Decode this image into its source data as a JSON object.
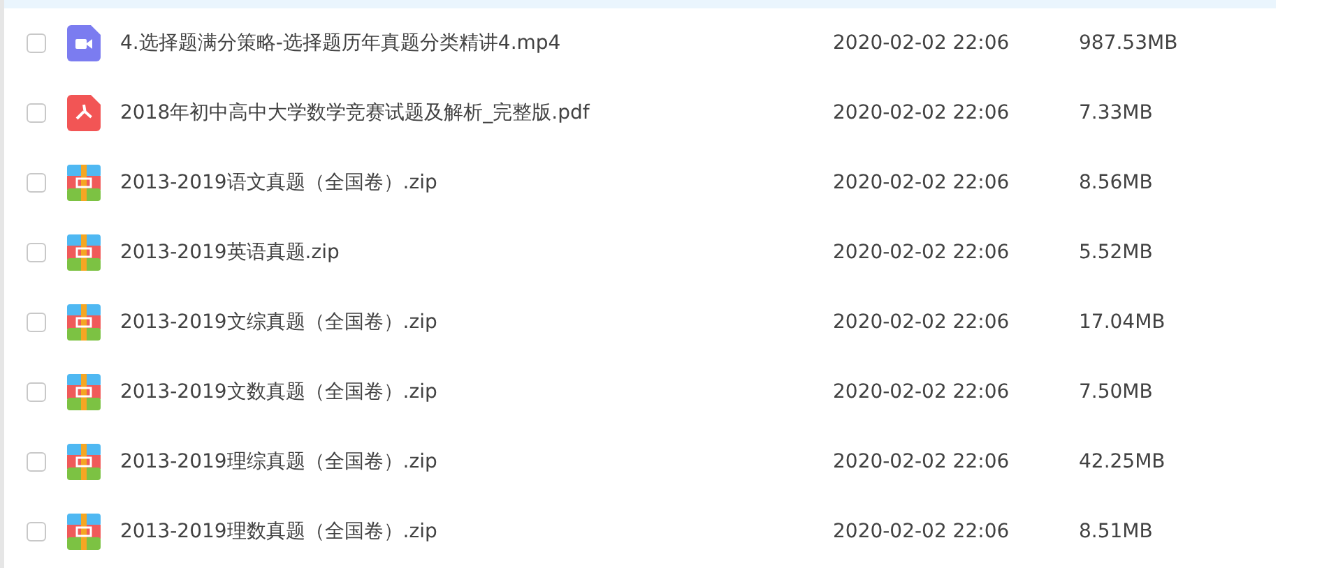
{
  "files": [
    {
      "kind": "video",
      "name": "4.选择题满分策略-选择题历年真题分类精讲4.mp4",
      "modified": "2020-02-02 22:06",
      "size": "987.53MB",
      "checked": false
    },
    {
      "kind": "pdf",
      "name": "2018年初中高中大学数学竞赛试题及解析_完整版.pdf",
      "modified": "2020-02-02 22:06",
      "size": "7.33MB",
      "checked": false
    },
    {
      "kind": "zip",
      "name": "2013-2019语文真题（全国卷）.zip",
      "modified": "2020-02-02 22:06",
      "size": "8.56MB",
      "checked": false
    },
    {
      "kind": "zip",
      "name": "2013-2019英语真题.zip",
      "modified": "2020-02-02 22:06",
      "size": "5.52MB",
      "checked": false
    },
    {
      "kind": "zip",
      "name": "2013-2019文综真题（全国卷）.zip",
      "modified": "2020-02-02 22:06",
      "size": "17.04MB",
      "checked": false
    },
    {
      "kind": "zip",
      "name": "2013-2019文数真题（全国卷）.zip",
      "modified": "2020-02-02 22:06",
      "size": "7.50MB",
      "checked": false
    },
    {
      "kind": "zip",
      "name": "2013-2019理综真题（全国卷）.zip",
      "modified": "2020-02-02 22:06",
      "size": "42.25MB",
      "checked": false
    },
    {
      "kind": "zip",
      "name": "2013-2019理数真题（全国卷）.zip",
      "modified": "2020-02-02 22:06",
      "size": "8.51MB",
      "checked": false
    }
  ]
}
